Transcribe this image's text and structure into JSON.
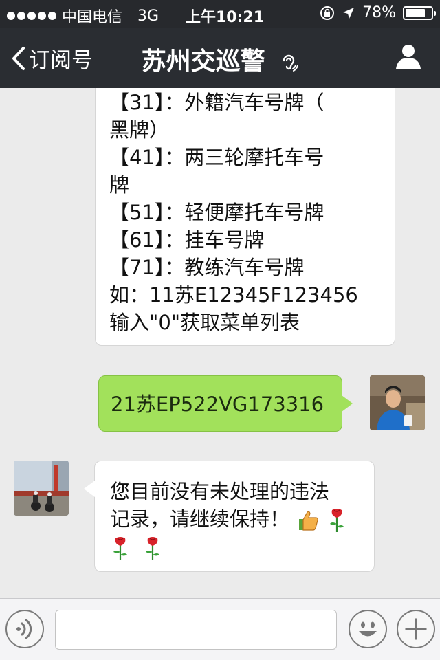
{
  "status": {
    "carrier": "中国电信",
    "network": "3G",
    "time": "上午10:21",
    "battery_text": "78%",
    "battery_level": 0.78
  },
  "nav": {
    "back_label": "订阅号",
    "title": "苏州交巡警"
  },
  "messages": {
    "menu_lines": [
      "【31】：外籍汽车号牌（",
      "黑牌）",
      "【41】：两三轮摩托车号",
      "牌",
      "【51】：轻便摩托车号牌",
      "【61】：挂车号牌",
      "【71】：教练汽车号牌",
      "如：11苏E12345F123456",
      "输入\"0\"获取菜单列表"
    ],
    "sent": "21苏EP522VG173316",
    "reply_line1": "您目前没有未处理的违法",
    "reply_line2": "记录，请继续保持！"
  },
  "input": {
    "value": ""
  },
  "icons": {
    "signal": "signal-dots-icon",
    "lock": "rotation-lock-icon",
    "location": "location-arrow-icon",
    "battery": "battery-icon",
    "back": "chevron-left-icon",
    "ear": "ear-icon",
    "profile": "person-icon",
    "voice": "voice-icon",
    "emoji": "smiley-icon",
    "plus": "plus-icon",
    "thumbs": "thumbs-up-icon",
    "rose": "rose-icon"
  },
  "colors": {
    "nav_bg": "#2a2d32",
    "chat_bg": "#ebebeb",
    "sent_bubble": "#a2e15b",
    "received_bubble": "#ffffff"
  }
}
